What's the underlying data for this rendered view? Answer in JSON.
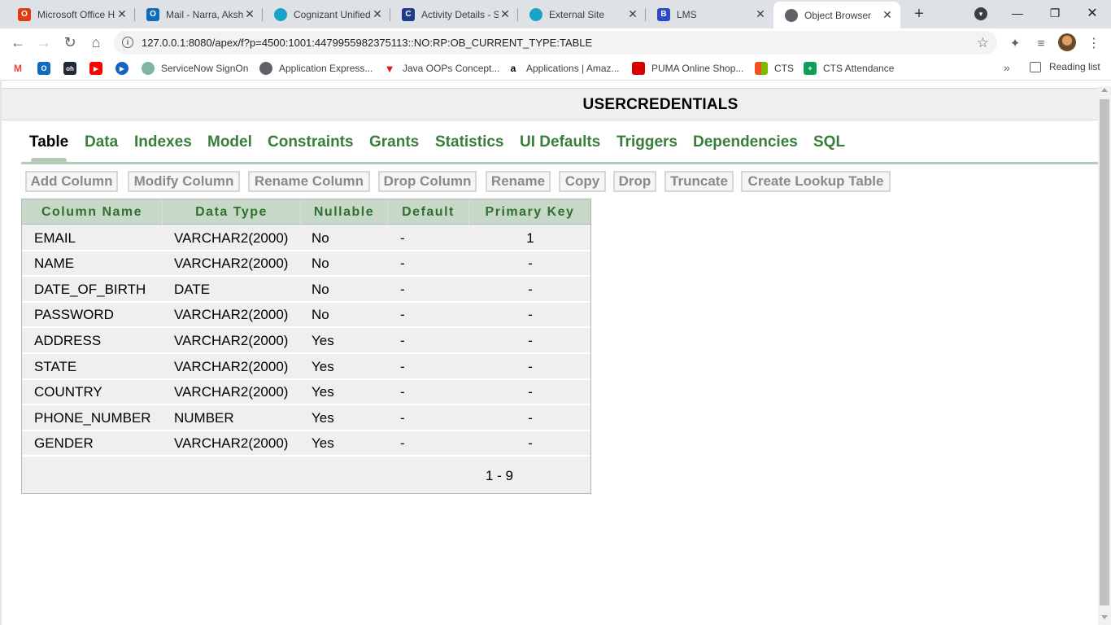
{
  "browser": {
    "tabs": [
      {
        "title": "Microsoft Office H",
        "icon": "office-icon",
        "color": "#e03c12"
      },
      {
        "title": "Mail - Narra, Akshi",
        "icon": "outlook-icon",
        "color": "#0f6cbd"
      },
      {
        "title": "Cognizant Unified",
        "icon": "cognizant-icon",
        "color": "#1aa3c8"
      },
      {
        "title": "Activity Details - S",
        "icon": "c-icon",
        "color": "#1e3a8a"
      },
      {
        "title": "External Site",
        "icon": "cognizant-icon",
        "color": "#1aa3c8"
      },
      {
        "title": "LMS",
        "icon": "b-icon",
        "color": "#2b4acb"
      },
      {
        "title": "Object Browser",
        "icon": "globe-icon",
        "color": "#5f6368"
      }
    ],
    "url": "127.0.0.1:8080/apex/f?p=4500:1001:4479955982375113::NO:RP:OB_CURRENT_TYPE:TABLE",
    "bookmarks": [
      {
        "label": "",
        "icon": "gmail-icon",
        "color": "#ea4335"
      },
      {
        "label": "",
        "icon": "outlook-icon",
        "color": "#0f6cbd"
      },
      {
        "label": "",
        "icon": "oh-icon",
        "color": "#1f2937"
      },
      {
        "label": "",
        "icon": "youtube-icon",
        "color": "#ff0000"
      },
      {
        "label": "",
        "icon": "play-icon",
        "color": "#1565c0"
      },
      {
        "label": "ServiceNow SignOn",
        "icon": "servicenow-icon",
        "color": "#81b5a1"
      },
      {
        "label": "Application Express...",
        "icon": "globe-icon",
        "color": "#5f6368"
      },
      {
        "label": "Java OOPs Concept...",
        "icon": "java-icon",
        "color": "#d81b1b"
      },
      {
        "label": "Applications | Amaz...",
        "icon": "amazon-icon",
        "color": "#ff9900"
      },
      {
        "label": "PUMA Online Shop...",
        "icon": "puma-icon",
        "color": "#d50000"
      },
      {
        "label": "CTS",
        "icon": "microsoft-icon",
        "color": "#f25022"
      },
      {
        "label": "CTS Attendance",
        "icon": "sheets-icon",
        "color": "#0f9d58"
      }
    ],
    "reading_list": "Reading list"
  },
  "object": {
    "title": "USERCREDENTIALS"
  },
  "subtabs": [
    "Table",
    "Data",
    "Indexes",
    "Model",
    "Constraints",
    "Grants",
    "Statistics",
    "UI Defaults",
    "Triggers",
    "Dependencies",
    "SQL"
  ],
  "actions": [
    "Add Column",
    "Modify Column",
    "Rename Column",
    "Drop Column",
    "Rename",
    "Copy",
    "Drop",
    "Truncate",
    "Create Lookup Table"
  ],
  "grid": {
    "headers": [
      "Column Name",
      "Data Type",
      "Nullable",
      "Default",
      "Primary Key"
    ],
    "rows": [
      [
        "EMAIL",
        "VARCHAR2(2000)",
        "No",
        "-",
        "1"
      ],
      [
        "NAME",
        "VARCHAR2(2000)",
        "No",
        "-",
        "-"
      ],
      [
        "DATE_OF_BIRTH",
        "DATE",
        "No",
        "-",
        "-"
      ],
      [
        "PASSWORD",
        "VARCHAR2(2000)",
        "No",
        "-",
        "-"
      ],
      [
        "ADDRESS",
        "VARCHAR2(2000)",
        "Yes",
        "-",
        "-"
      ],
      [
        "STATE",
        "VARCHAR2(2000)",
        "Yes",
        "-",
        "-"
      ],
      [
        "COUNTRY",
        "VARCHAR2(2000)",
        "Yes",
        "-",
        "-"
      ],
      [
        "PHONE_NUMBER",
        "NUMBER",
        "Yes",
        "-",
        "-"
      ],
      [
        "GENDER",
        "VARCHAR2(2000)",
        "Yes",
        "-",
        "-"
      ]
    ],
    "pagination": "1 - 9"
  },
  "colors": {
    "tab_link": "#3a7d3a",
    "header_bg": "#c8d8c8",
    "row_bg": "#efefef"
  }
}
